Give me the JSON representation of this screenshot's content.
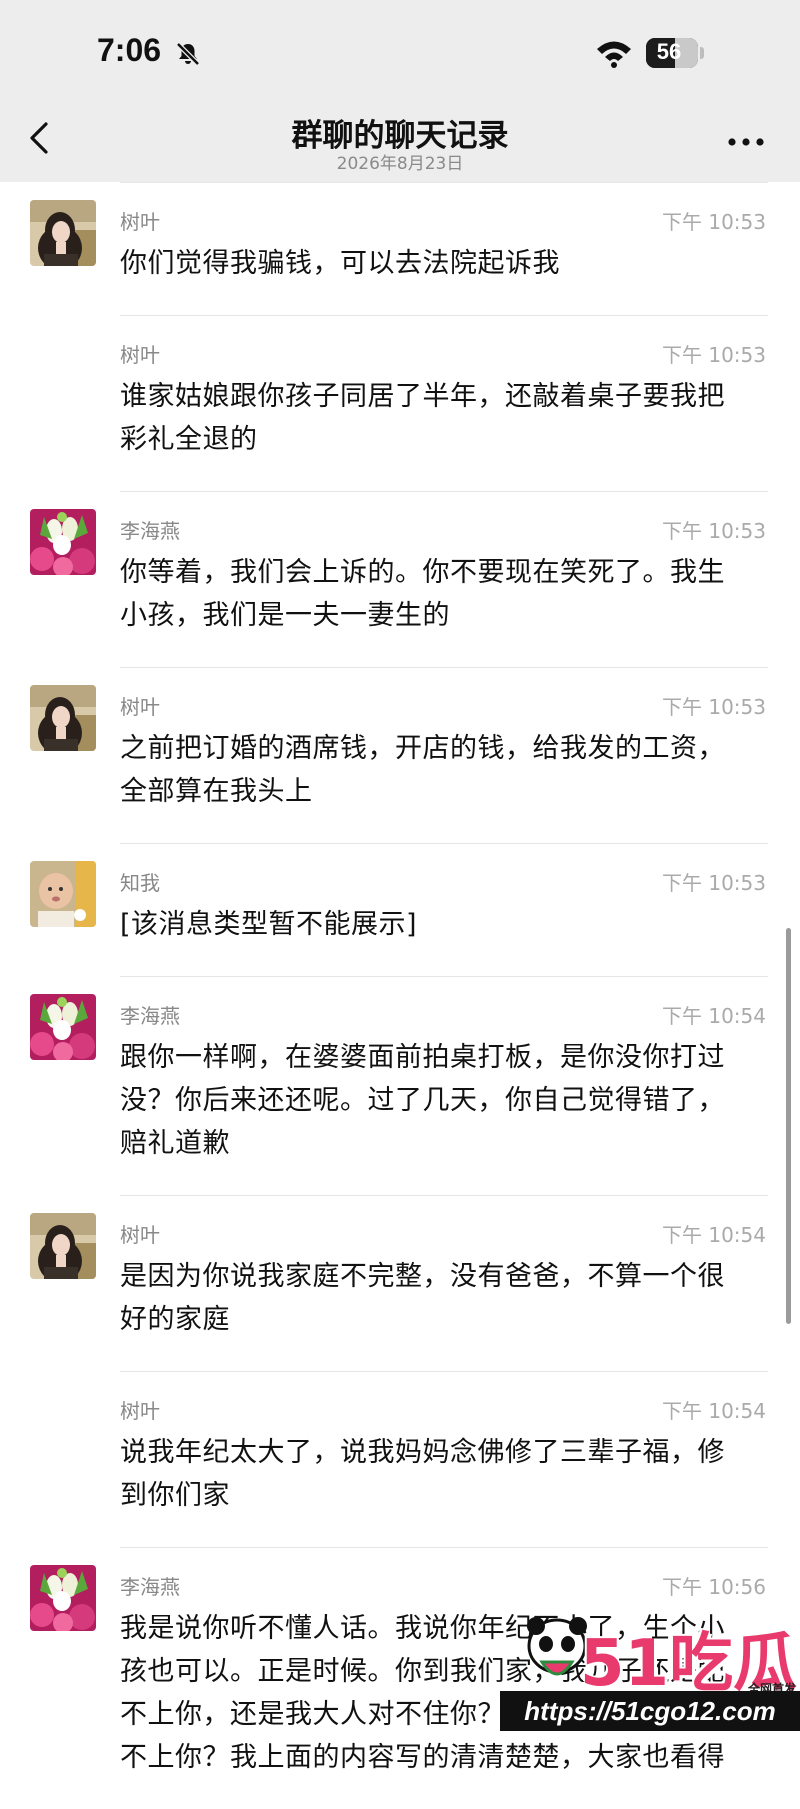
{
  "status_bar": {
    "time": "7:06",
    "battery": "56",
    "battery_level_percent": 56
  },
  "header": {
    "title": "群聊的聊天记录",
    "subtitle": "2026年8月23日"
  },
  "messages": [
    {
      "sender": "树叶",
      "time": "下午 10:53",
      "avatar": "girl-photo",
      "lines": [
        "你们觉得我骗钱，可以去法院起诉我"
      ]
    },
    {
      "sender": "树叶",
      "time": "下午 10:53",
      "avatar": "",
      "lines": [
        "谁家姑娘跟你孩子同居了半年，还敲着桌子要我把",
        "彩礼全退的"
      ]
    },
    {
      "sender": "李海燕",
      "time": "下午 10:53",
      "avatar": "flower-bouquet",
      "lines": [
        "你等着，我们会上诉的。你不要现在笑死了。我生",
        "小孩，我们是一夫一妻生的"
      ]
    },
    {
      "sender": "树叶",
      "time": "下午 10:53",
      "avatar": "girl-photo",
      "lines": [
        "之前把订婚的酒席钱，开店的钱，给我发的工资，",
        "全部算在我头上"
      ]
    },
    {
      "sender": "知我",
      "time": "下午 10:53",
      "avatar": "baby-photo",
      "lines": [
        "[该消息类型暂不能展示]"
      ]
    },
    {
      "sender": "李海燕",
      "time": "下午 10:54",
      "avatar": "flower-bouquet",
      "lines": [
        "跟你一样啊，在婆婆面前拍桌打板，是你没你打过",
        "没？你后来还还呢。过了几天，你自己觉得错了，",
        "赔礼道歉"
      ]
    },
    {
      "sender": "树叶",
      "time": "下午 10:54",
      "avatar": "girl-photo",
      "lines": [
        "是因为你说我家庭不完整，没有爸爸，不算一个很",
        "好的家庭"
      ]
    },
    {
      "sender": "树叶",
      "time": "下午 10:54",
      "avatar": "",
      "lines": [
        "说我年纪太大了，说我妈妈念佛修了三辈子福，修",
        "到你们家"
      ]
    },
    {
      "sender": "李海燕",
      "time": "下午 10:56",
      "avatar": "flower-bouquet",
      "lines": [
        "我是说你听不懂人话。我说你年纪不小了，生个小",
        "孩也可以。正是时候。你到我们家，我儿子还是配",
        "不上你，还是我大人对不住你？",
        "不上你？我上面的内容写的清清楚楚，大家也看得"
      ]
    }
  ],
  "watermark": {
    "logo": "51吃瓜",
    "tag": "全网首发",
    "url": "https://51cgo12.com"
  },
  "colors": {
    "header_bg": "#ededed",
    "accent_pink": "#e83a6c"
  }
}
